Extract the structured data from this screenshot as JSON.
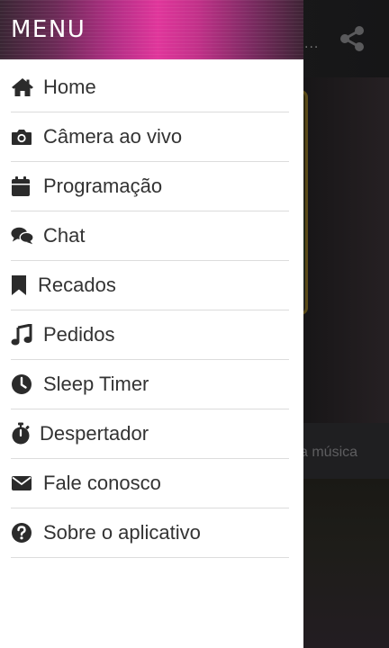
{
  "drawer": {
    "title": "MENU",
    "items": [
      {
        "label": "Home",
        "icon": "home-icon"
      },
      {
        "label": "Câmera ao vivo",
        "icon": "camera-icon"
      },
      {
        "label": "Programação",
        "icon": "calendar-icon"
      },
      {
        "label": "Chat",
        "icon": "chat-icon"
      },
      {
        "label": "Recados",
        "icon": "bookmark-icon"
      },
      {
        "label": "Pedidos",
        "icon": "music-note-icon"
      },
      {
        "label": "Sleep Timer",
        "icon": "clock-icon"
      },
      {
        "label": "Despertador",
        "icon": "stopwatch-icon"
      },
      {
        "label": "Fale conosco",
        "icon": "envelope-icon"
      },
      {
        "label": "Sobre o aplicativo",
        "icon": "question-icon"
      }
    ]
  },
  "background": {
    "header_dots": "...",
    "bar_text": "a música"
  },
  "colors": {
    "header_accent": "#e0369b",
    "menu_text": "#333333",
    "icon": "#2b2b2b",
    "divider": "#dcdcdc"
  }
}
